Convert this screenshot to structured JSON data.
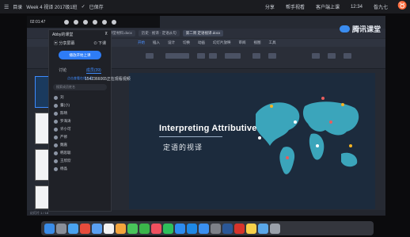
{
  "menubar": {
    "app_menu": "目录",
    "doc_title": "Week 4 视译 2017级1班",
    "saved": "已保存",
    "items": [
      "分享",
      "帮手视看",
      "客户端上课"
    ],
    "time": "12:34",
    "user": "昝九七"
  },
  "control": {
    "timer": "02:01:47"
  },
  "wps": {
    "tabs": [
      "课堂材料.docx",
      "历史 · 视译 · 定语从句",
      "第二周 定语视译.docx"
    ],
    "menu": [
      "开始",
      "插入",
      "设计",
      "切换",
      "动画",
      "幻灯片放映",
      "审阅",
      "视图",
      "工具"
    ],
    "active_menu": "开始"
  },
  "brand": {
    "name": "腾讯课堂"
  },
  "classpanel": {
    "title": "Abby的课堂",
    "share_label": "分享屏幕",
    "course_label": "下课",
    "primary_button": "播放开始上课",
    "tabs": [
      "讨论",
      "成员(39)"
    ],
    "active_tab": "成员(39)",
    "sub_label": "点击查看在线人员",
    "search_placeholder": "搜索成员姓名",
    "members": [
      "刘",
      "董(小)",
      "陈晴",
      "罗海涛",
      "许小可",
      "严修",
      "魏嘉",
      "韩思聪",
      "王欣欣",
      "杨晶"
    ]
  },
  "notice": {
    "text": "1542366065正在观看视频"
  },
  "slide": {
    "title": "Interpreting Attributive",
    "subtitle": "定语的视译",
    "caption": ""
  },
  "status": {
    "text": "幻灯片 1 / 18"
  },
  "colors": {
    "accent": "#2e7cf6",
    "slide_bg": "#1c2b3d",
    "map": "#3fb3c9"
  }
}
